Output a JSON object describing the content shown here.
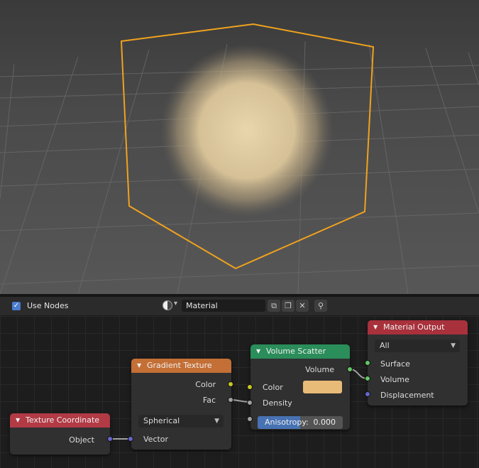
{
  "colors": {
    "input_header": "#b13a45",
    "texture_header": "#c46f35",
    "shader_header": "#2a8d5a",
    "output_header": "#a8313c",
    "selection_outline": "#f0a21e",
    "volume_color": "#e8bb78",
    "socket_vector": "#6666cc",
    "socket_color": "#c7c729",
    "socket_float": "#a1a1a1",
    "socket_shader": "#63c763",
    "slider_fill": "#4772b3"
  },
  "header": {
    "use_nodes_label": "Use Nodes",
    "use_nodes_checked": true,
    "material_name": "Material",
    "icons": [
      "material-sphere-icon",
      "chevron-down-icon",
      "browse-icon",
      "duplicate-icon",
      "close-icon",
      "pin-icon"
    ]
  },
  "nodes": {
    "texture_coordinate": {
      "title": "Texture Coordinate",
      "output_object": "Object"
    },
    "gradient_texture": {
      "title": "Gradient Texture",
      "output_color": "Color",
      "output_fac": "Fac",
      "type": "Spherical",
      "input_vector": "Vector"
    },
    "volume_scatter": {
      "title": "Volume Scatter",
      "output_volume": "Volume",
      "input_color": "Color",
      "input_density": "Density",
      "anisotropy_label": "Anisotropy:",
      "anisotropy_value": "0.000",
      "anisotropy_fraction": 0.5
    },
    "material_output": {
      "title": "Material Output",
      "target": "All",
      "input_surface": "Surface",
      "input_volume": "Volume",
      "input_displacement": "Displacement"
    }
  }
}
